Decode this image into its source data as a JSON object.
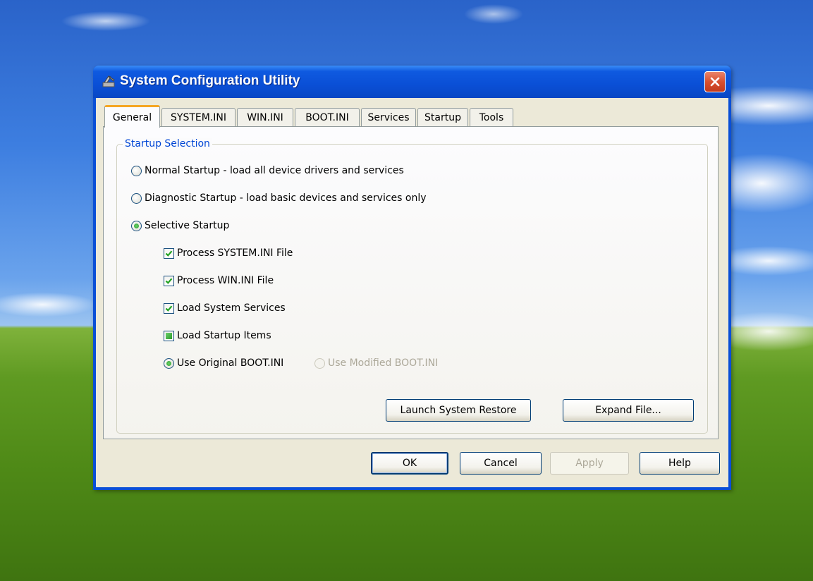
{
  "window": {
    "title": "System Configuration Utility"
  },
  "tabs": [
    {
      "label": "General",
      "active": true
    },
    {
      "label": "SYSTEM.INI",
      "active": false
    },
    {
      "label": "WIN.INI",
      "active": false
    },
    {
      "label": "BOOT.INI",
      "active": false
    },
    {
      "label": "Services",
      "active": false
    },
    {
      "label": "Startup",
      "active": false
    },
    {
      "label": "Tools",
      "active": false
    }
  ],
  "startup_selection": {
    "group_label": "Startup Selection",
    "normal": {
      "label": "Normal Startup - load all device drivers and services",
      "selected": false
    },
    "diagnostic": {
      "label": "Diagnostic Startup - load basic devices and services only",
      "selected": false
    },
    "selective": {
      "label": "Selective Startup",
      "selected": true
    },
    "options": {
      "system_ini": {
        "label": "Process SYSTEM.INI File",
        "state": "checked"
      },
      "win_ini": {
        "label": "Process WIN.INI File",
        "state": "checked"
      },
      "system_services": {
        "label": "Load System Services",
        "state": "checked"
      },
      "startup_items": {
        "label": "Load Startup Items",
        "state": "indeterminate"
      }
    },
    "boot_ini": {
      "original": {
        "label": "Use Original BOOT.INI",
        "selected": true
      },
      "modified": {
        "label": "Use Modified BOOT.INI",
        "selected": false,
        "disabled": true
      }
    },
    "launch_restore_label": "Launch System Restore",
    "expand_file_label": "Expand File..."
  },
  "footer": {
    "ok_label": "OK",
    "cancel_label": "Cancel",
    "apply_label": "Apply",
    "help_label": "Help"
  },
  "colors": {
    "titlebar": "#0a4fd6",
    "client_bg": "#ece9d8",
    "group_label": "#0046d5",
    "active_tab_accent": "#f5a623",
    "check_green": "#2e9a2e",
    "close_button": "#d8502f"
  }
}
